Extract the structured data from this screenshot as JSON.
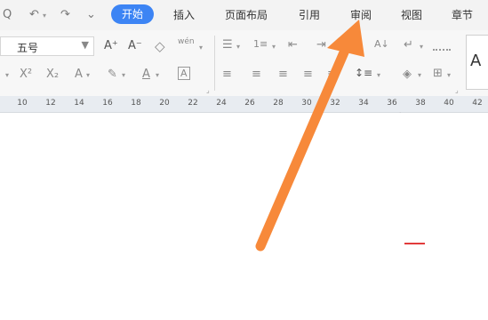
{
  "quick_access": {
    "search_icon": "Q",
    "undo_icon": "↶",
    "redo_icon": "↷",
    "customize_icon": "⌄"
  },
  "menu_tabs": [
    "开始",
    "插入",
    "页面布局",
    "引用",
    "审阅",
    "视图",
    "章节"
  ],
  "active_tab": "开始",
  "font_size": {
    "value": "五号",
    "dropdown_icon": "▼"
  },
  "ribbon": {
    "grow_font": "A⁺",
    "shrink_font": "A⁻",
    "clear_format": "◇",
    "phonetic_guide": "wén",
    "superscript": "X²",
    "subscript": "X₂",
    "text_effect": "A",
    "highlight": "✎",
    "font_color": "A",
    "char_border": "A",
    "bullets": "☰",
    "numbering": "1≡",
    "decrease_indent": "⇤",
    "increase_indent": "⇥",
    "sort": "A↓",
    "show_marks": "↵",
    "align_left": "≡",
    "align_center": "≡",
    "align_right": "≡",
    "justify": "≡",
    "distributed": "≡",
    "line_spacing": "↕≡",
    "shading": "◈",
    "borders": "⊞",
    "style_preview": "A"
  },
  "ruler_ticks": [
    "10",
    "12",
    "14",
    "16",
    "18",
    "20",
    "22",
    "24",
    "26",
    "28",
    "30",
    "32",
    "34",
    "36",
    "38",
    "40",
    "42"
  ],
  "colors": {
    "accent": "#3c84f4",
    "annotation_arrow": "#f7893a",
    "red_mark": "#e23b3b"
  }
}
